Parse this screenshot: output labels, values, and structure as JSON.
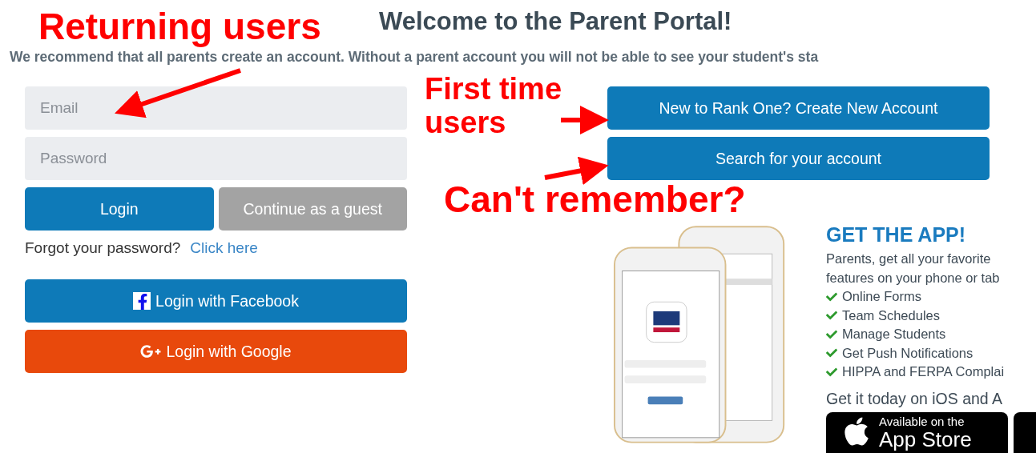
{
  "title": "Welcome to the Parent Portal!",
  "intro": "We recommend that all parents create an account. Without a parent account you will not be able to see your student's sta",
  "login": {
    "email": {
      "placeholder": "Email"
    },
    "password": {
      "placeholder": "Password"
    },
    "login_button": "Login",
    "guest_button": "Continue as a guest",
    "forgot": {
      "text": "Forgot your password?",
      "link": "Click here"
    },
    "social": [
      {
        "kind": "facebook",
        "label": "Login with Facebook"
      },
      {
        "kind": "google",
        "label": "Login with Google"
      }
    ]
  },
  "account_buttons": [
    "New to Rank One? Create New Account",
    "Search for your account"
  ],
  "app": {
    "heading": "GET THE APP!",
    "description_lines": [
      "Parents, get all your favorite",
      "features on your phone or tab"
    ],
    "features": [
      "Online Forms",
      "Team Schedules",
      "Manage Students",
      "Get Push Notifications",
      "HIPPA and FERPA Complai"
    ],
    "cta": "Get it today on iOS and A",
    "badge": {
      "line_1": "Available on the",
      "line_2": "App Store"
    }
  },
  "annotations": [
    "Returning users",
    "First time users",
    "Can't remember?"
  ]
}
